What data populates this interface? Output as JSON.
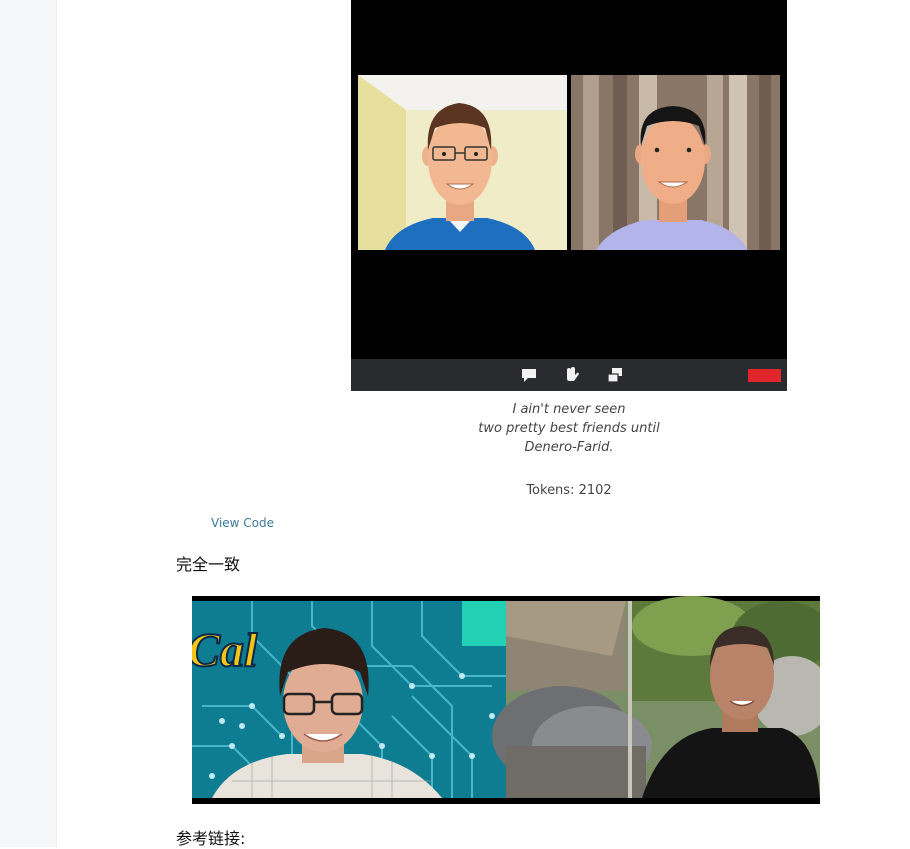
{
  "caption": {
    "line1": "I ain't never seen",
    "line2": "two pretty best friends until",
    "line3": "Denero-Farid."
  },
  "tokens_text": "Tokens: 2102",
  "view_code_label": "View Code",
  "heading_match": "完全一致",
  "heading_refs": "参考链接:",
  "toolbar": {
    "icons": [
      "chat-bubble-icon",
      "raise-hand-icon",
      "screen-share-icon"
    ],
    "end_call_color": "#e0262a"
  },
  "photo": {
    "logo_text": "Cal"
  }
}
